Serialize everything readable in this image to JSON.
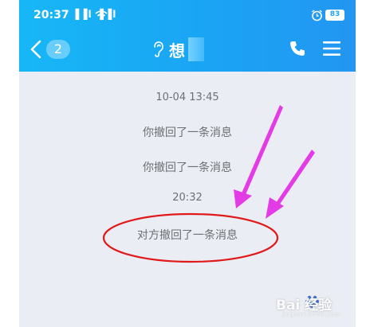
{
  "status": {
    "time": "20:37",
    "signal": "▐▐l ▐▐l",
    "battery": "83"
  },
  "nav": {
    "back_badge": "2",
    "title": "想"
  },
  "messages": [
    {
      "kind": "timestamp",
      "text": "10-04 13:45"
    },
    {
      "kind": "system",
      "text": "你撤回了一条消息"
    },
    {
      "kind": "system",
      "text": "你撤回了一条消息"
    },
    {
      "kind": "timestamp",
      "text": "20:32"
    },
    {
      "kind": "system",
      "text": "对方撤回了一条消息"
    }
  ],
  "annotation": {
    "arrow_color": "#e33ce6",
    "circle_color": "#e01a1a"
  },
  "watermark": {
    "brand": "Bai  经验",
    "sub": "jingyan.baidu.com"
  },
  "colors": {
    "header_start": "#17b7f6",
    "header_end": "#2296f2",
    "chat_bg": "#eaedf3"
  }
}
